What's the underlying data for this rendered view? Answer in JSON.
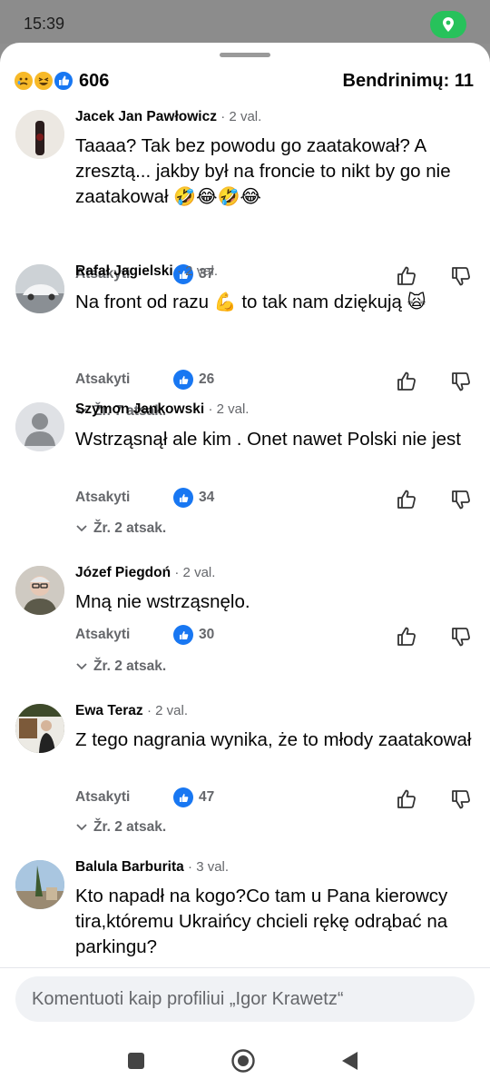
{
  "status_bar": {
    "time": "15:39",
    "location_icon": "location-pin-icon",
    "pill_color": "#27c25b"
  },
  "reaction_bar": {
    "icons": [
      "sad-emoji-icon",
      "laugh-emoji-icon",
      "like-icon"
    ],
    "count": "606",
    "shares": "Bendrinimų: 11"
  },
  "colors": {
    "like_blue": "#1877f2",
    "meta_gray": "#65676b",
    "composer_bg": "#f0f2f5"
  },
  "comments": [
    {
      "name": "Jacek Jan Pawłowicz",
      "time": "· 2 val.",
      "text": "Taaaa? Tak bez powodu go zaatakował? A zresztą... jakby był na froncie to nikt by go nie zaatakował",
      "emojis": "🤣😂🤣😂",
      "reply_label": "Atsakyti",
      "likes": "37",
      "replies": ""
    },
    {
      "name": "Rafał Jagielski",
      "time": "· 2 val.",
      "text": "Na front od razu",
      "emoji_mid": "💪",
      "text2": "to tak nam dziękują",
      "emojis": "🙀",
      "reply_label": "Atsakyti",
      "likes": "26",
      "replies": "Žr. 7 atsak."
    },
    {
      "name": "Szymon Jankowski",
      "time": "· 2 val.",
      "text": "Wstrząsnął ale kim . Onet nawet Polski nie jest",
      "reply_label": "Atsakyti",
      "likes": "34",
      "replies": "Žr. 2 atsak."
    },
    {
      "name": "Józef Piegdoń",
      "time": "· 2 val.",
      "text": "Mną nie wstrząsnęlo.",
      "reply_label": "Atsakyti",
      "likes": "30",
      "replies": "Žr. 2 atsak."
    },
    {
      "name": "Ewa Teraz",
      "time": "· 2 val.",
      "text": "Z tego nagrania  wynika, że to młody zaatakował",
      "reply_label": "Atsakyti",
      "likes": "47",
      "replies": "Žr. 2 atsak."
    },
    {
      "name": "Balula Barburita",
      "time": "· 3 val.",
      "text": "Kto napadł na kogo?Co tam u Pana kierowcy tira,któremu Ukraińcy chcieli rękę odrąbać na parkingu?"
    }
  ],
  "composer": {
    "placeholder": "Komentuoti kaip profiliui „Igor Krawetz“"
  },
  "navbar": {
    "icons": [
      "recents-square-icon",
      "home-circle-icon",
      "back-triangle-icon"
    ]
  }
}
